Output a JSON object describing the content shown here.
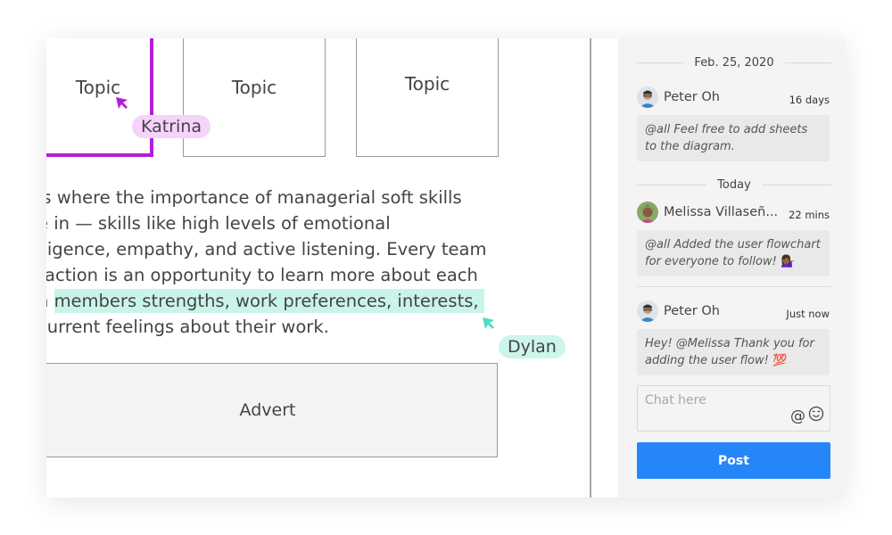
{
  "canvas": {
    "topics": [
      "Topic",
      "Topic",
      "Topic"
    ],
    "collaborators": [
      {
        "name": "Katrina",
        "color": "#b21fd8",
        "tag_color": "#f5d3fa"
      },
      {
        "name": "Dylan",
        "color": "#4fdcc0",
        "tag_color": "#cdf5ec"
      }
    ],
    "paragraph": {
      "line1": "is where the importance of managerial soft skills",
      "line2": "e in — skills like high levels of emotional",
      "line3": "lligence, empathy, and active listening. Every team",
      "line4": "raction is an opportunity to learn more about each",
      "line5_prefix": "n ",
      "line5_highlight": "members strengths, work preferences, interests,",
      "line6": "current feelings about their work."
    },
    "advert_label": "Advert"
  },
  "chat": {
    "date_separator": "Feb. 25, 2020",
    "today_separator": "Today",
    "messages": [
      {
        "author": "Peter Oh",
        "time": "16 days",
        "text": "@all Feel free to add sheets to the diagram.",
        "emoji": ""
      },
      {
        "author": "Melissa Villaseñ...",
        "time": "22 mins",
        "text": "@all Added the user flowchart for everyone to follow!",
        "emoji": "💁🏾‍♀️"
      },
      {
        "author": "Peter Oh",
        "time": "Just now",
        "text": "Hey! @Melissa Thank you for adding the user flow!",
        "emoji": "💯"
      }
    ],
    "input_placeholder": "Chat here",
    "mention_icon": "@",
    "emoji_icon": "☺",
    "post_label": "Post",
    "accent_color": "#2586fa"
  }
}
